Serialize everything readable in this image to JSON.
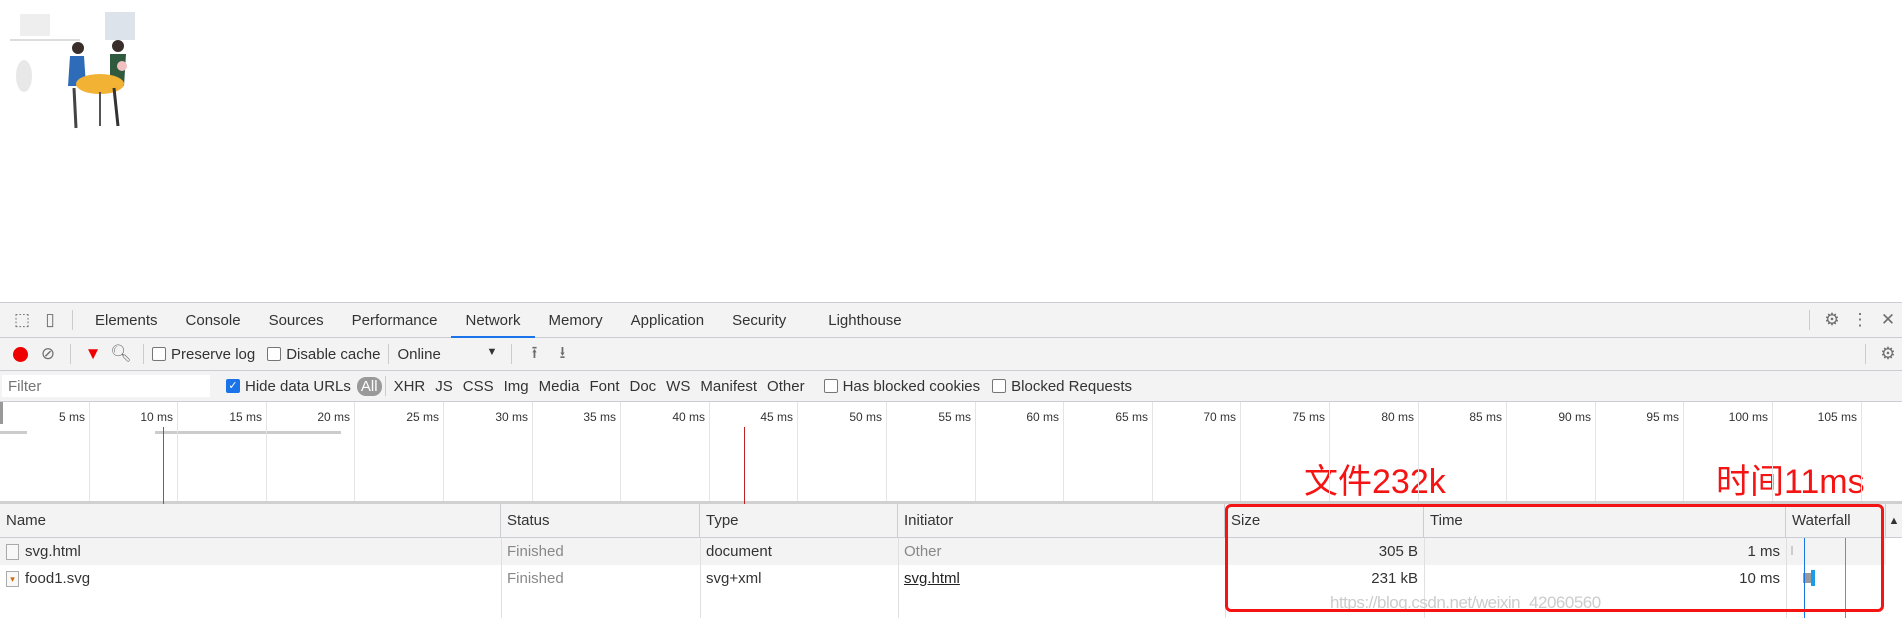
{
  "devtools": {
    "tabs": [
      "Elements",
      "Console",
      "Sources",
      "Performance",
      "Network",
      "Memory",
      "Application",
      "Security",
      "Lighthouse"
    ],
    "active_tab": "Network",
    "toolbar": {
      "preserve_log": "Preserve log",
      "disable_cache": "Disable cache",
      "throttle": "Online"
    },
    "filter": {
      "placeholder": "Filter",
      "hide_data_urls": "Hide data URLs",
      "types": [
        "All",
        "XHR",
        "JS",
        "CSS",
        "Img",
        "Media",
        "Font",
        "Doc",
        "WS",
        "Manifest",
        "Other"
      ],
      "has_blocked_cookies": "Has blocked cookies",
      "blocked_requests": "Blocked Requests"
    },
    "timeline": {
      "ticks": [
        "5 ms",
        "10 ms",
        "15 ms",
        "20 ms",
        "25 ms",
        "30 ms",
        "35 ms",
        "40 ms",
        "45 ms",
        "50 ms",
        "55 ms",
        "60 ms",
        "65 ms",
        "70 ms",
        "75 ms",
        "80 ms",
        "85 ms",
        "90 ms",
        "95 ms",
        "100 ms",
        "105 ms"
      ],
      "dom_content_loaded_ms": 9.2,
      "load_ms": 42
    },
    "table": {
      "columns": [
        "Name",
        "Status",
        "Type",
        "Initiator",
        "Size",
        "Time",
        "Waterfall"
      ],
      "rows": [
        {
          "name": "svg.html",
          "status": "Finished",
          "type": "document",
          "initiator": "Other",
          "size": "305 B",
          "time": "1 ms"
        },
        {
          "name": "food1.svg",
          "status": "Finished",
          "type": "svg+xml",
          "initiator": "svg.html",
          "size": "231 kB",
          "time": "10 ms"
        }
      ]
    }
  },
  "annotations": {
    "size_note": "文件232k",
    "time_note": "时间11ms",
    "color": "#f41414"
  },
  "watermark": "https://blog.csdn.net/weixin_42060560"
}
